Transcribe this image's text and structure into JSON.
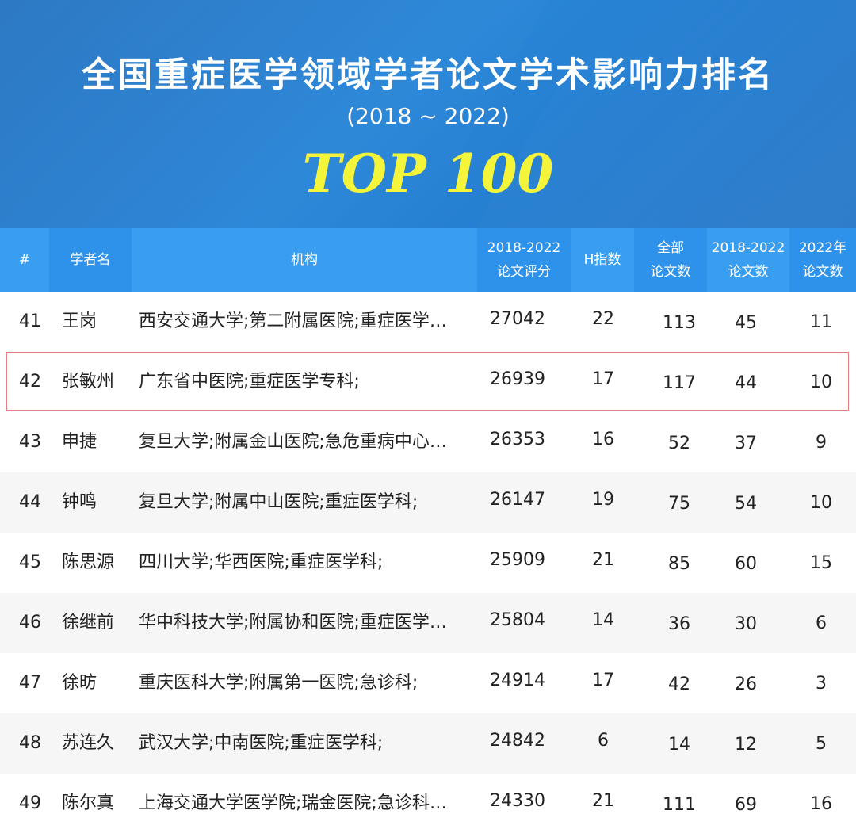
{
  "header": {
    "title": "全国重症医学领域学者论文学术影响力排名",
    "period": "(2018 ~ 2022)",
    "badge": "TOP 100"
  },
  "columns": {
    "rank": "#",
    "name": "学者名",
    "institution": "机构",
    "score_l1": "2018-2022",
    "score_l2": "论文评分",
    "h_index": "H指数",
    "total_l1": "全部",
    "total_l2": "论文数",
    "recent_l1": "2018-2022",
    "recent_l2": "论文数",
    "year_l1": "2022年",
    "year_l2": "论文数"
  },
  "rows": [
    {
      "rank": "41",
      "name": "王岗",
      "institution": "西安交通大学;第二附属医院;重症医学…",
      "score": "27042",
      "h_index": "22",
      "total": "113",
      "recent": "45",
      "year2022": "11"
    },
    {
      "rank": "42",
      "name": "张敏州",
      "institution": "广东省中医院;重症医学专科;",
      "score": "26939",
      "h_index": "17",
      "total": "117",
      "recent": "44",
      "year2022": "10"
    },
    {
      "rank": "43",
      "name": "申捷",
      "institution": "复旦大学;附属金山医院;急危重病中心…",
      "score": "26353",
      "h_index": "16",
      "total": "52",
      "recent": "37",
      "year2022": "9"
    },
    {
      "rank": "44",
      "name": "钟鸣",
      "institution": "复旦大学;附属中山医院;重症医学科;",
      "score": "26147",
      "h_index": "19",
      "total": "75",
      "recent": "54",
      "year2022": "10"
    },
    {
      "rank": "45",
      "name": "陈思源",
      "institution": "四川大学;华西医院;重症医学科;",
      "score": "25909",
      "h_index": "21",
      "total": "85",
      "recent": "60",
      "year2022": "15"
    },
    {
      "rank": "46",
      "name": "徐继前",
      "institution": "华中科技大学;附属协和医院;重症医学…",
      "score": "25804",
      "h_index": "14",
      "total": "36",
      "recent": "30",
      "year2022": "6"
    },
    {
      "rank": "47",
      "name": "徐昉",
      "institution": "重庆医科大学;附属第一医院;急诊科;",
      "score": "24914",
      "h_index": "17",
      "total": "42",
      "recent": "26",
      "year2022": "3"
    },
    {
      "rank": "48",
      "name": "苏连久",
      "institution": "武汉大学;中南医院;重症医学科;",
      "score": "24842",
      "h_index": "6",
      "total": "14",
      "recent": "12",
      "year2022": "5"
    },
    {
      "rank": "49",
      "name": "陈尔真",
      "institution": "上海交通大学医学院;瑞金医院;急诊科…",
      "score": "24330",
      "h_index": "21",
      "total": "111",
      "recent": "69",
      "year2022": "16"
    }
  ],
  "highlighted_rank": "42"
}
